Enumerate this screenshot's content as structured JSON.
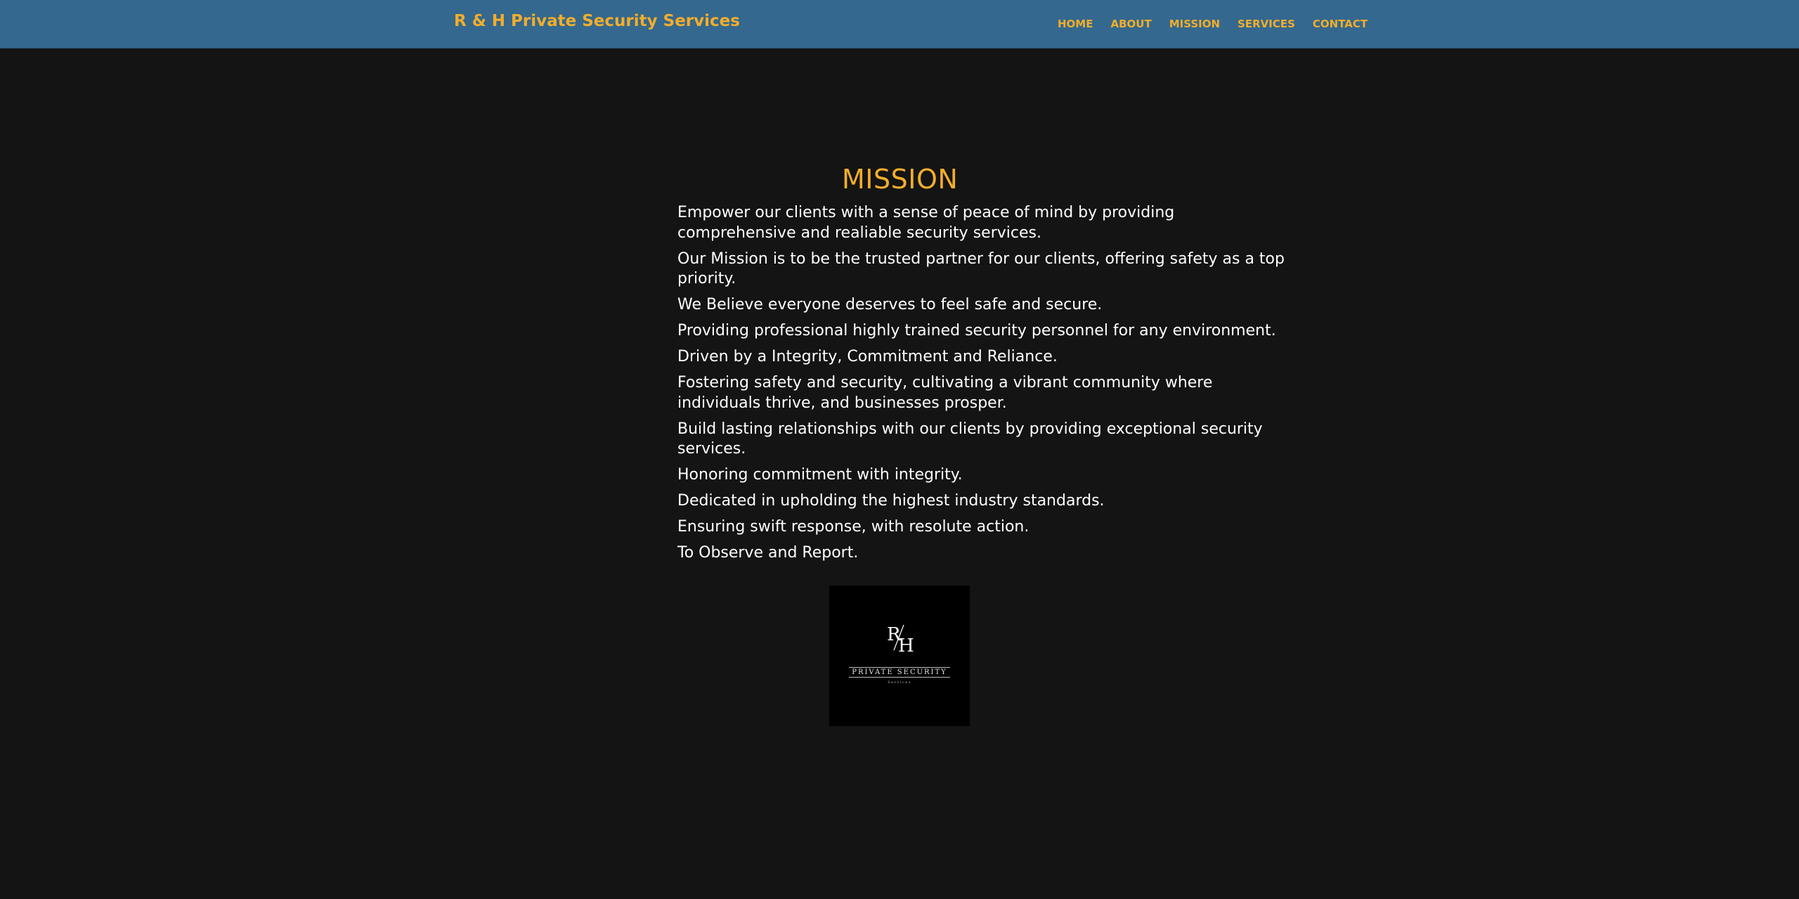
{
  "header": {
    "brand": "R & H Private Security Services",
    "nav": [
      {
        "label": "HOME"
      },
      {
        "label": "ABOUT"
      },
      {
        "label": "MISSION"
      },
      {
        "label": "SERVICES"
      },
      {
        "label": "CONTACT"
      }
    ]
  },
  "mission": {
    "title": "MISSION",
    "statements": [
      "Empower our clients with a sense of peace of mind by providing comprehensive and realiable security services.",
      "Our Mission is to be the trusted partner for our clients, offering safety as a top priority.",
      "We Believe everyone deserves to feel safe and secure.",
      "Providing professional highly trained security personnel for any environment.",
      "Driven by a Integrity, Commitment and Reliance.",
      "Fostering safety and security, cultivating a vibrant community where individuals thrive, and businesses prosper.",
      "Build lasting relationships with our clients by providing exceptional security services.",
      "Honoring commitment with integrity.",
      "Dedicated in upholding the highest industry standards.",
      "Ensuring swift response, with resolute action.",
      "To Observe and Report."
    ]
  },
  "logo": {
    "monogram": "R/H",
    "caption": "PRIVATE SECURITY",
    "sub": "Services"
  },
  "colors": {
    "header_bg": "#34688e",
    "accent": "#f2ad2b",
    "page_bg": "#141414",
    "body_text": "#ffffff"
  }
}
